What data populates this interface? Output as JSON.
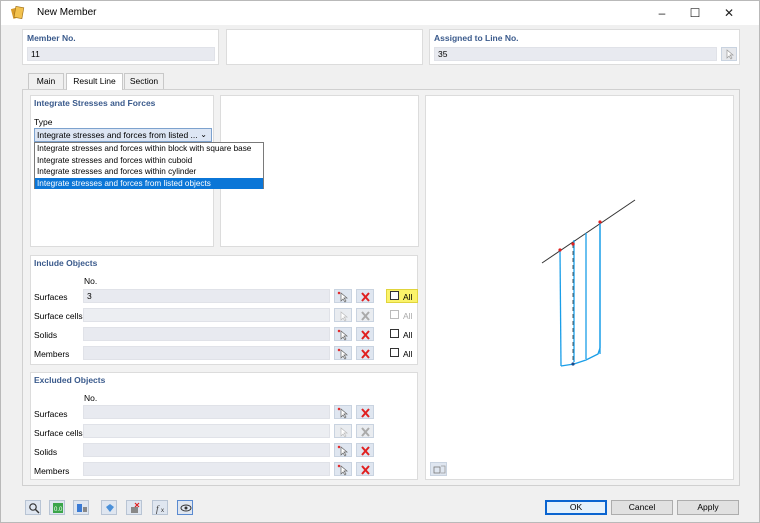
{
  "window": {
    "title": "New Member",
    "minimize_icon": "minimize-icon",
    "maximize_icon": "maximize-icon",
    "close_icon": "close-icon"
  },
  "header": {
    "member_no_label": "Member No.",
    "member_no_value": "11",
    "assigned_label": "Assigned to Line No.",
    "assigned_value": "35"
  },
  "tabs": [
    {
      "label": "Main",
      "active": false
    },
    {
      "label": "Result Line",
      "active": true
    },
    {
      "label": "Section",
      "active": false
    }
  ],
  "integrate": {
    "title": "Integrate Stresses and Forces",
    "type_label": "Type",
    "selected": "Integrate stresses and forces from listed ...",
    "options": [
      "Integrate stresses and forces within block with square base",
      "Integrate stresses and forces within cuboid",
      "Integrate stresses and forces within cylinder",
      "Integrate stresses and forces from listed objects"
    ],
    "selected_index": 3
  },
  "include": {
    "title": "Include Objects",
    "no_header": "No.",
    "all_label": "All",
    "rows": [
      {
        "label": "Surfaces",
        "value": "3",
        "enabled": true,
        "all_checked": false
      },
      {
        "label": "Surface cells",
        "value": "",
        "enabled": false,
        "all_checked": false
      },
      {
        "label": "Solids",
        "value": "",
        "enabled": true,
        "all_checked": false
      },
      {
        "label": "Members",
        "value": "",
        "enabled": true,
        "all_checked": false
      }
    ]
  },
  "exclude": {
    "title": "Excluded Objects",
    "no_header": "No.",
    "rows": [
      {
        "label": "Surfaces",
        "value": "",
        "enabled": true
      },
      {
        "label": "Surface cells",
        "value": "",
        "enabled": false
      },
      {
        "label": "Solids",
        "value": "",
        "enabled": true
      },
      {
        "label": "Members",
        "value": "",
        "enabled": true
      }
    ]
  },
  "buttons": {
    "ok": "OK",
    "cancel": "Cancel",
    "apply": "Apply"
  },
  "colors": {
    "accent": "#0b76d7",
    "member_blue": "#1a9ee8",
    "delete_red": "#e02020",
    "highlight_yellow": "#fbf36a",
    "group_title": "#3a5a8c"
  }
}
